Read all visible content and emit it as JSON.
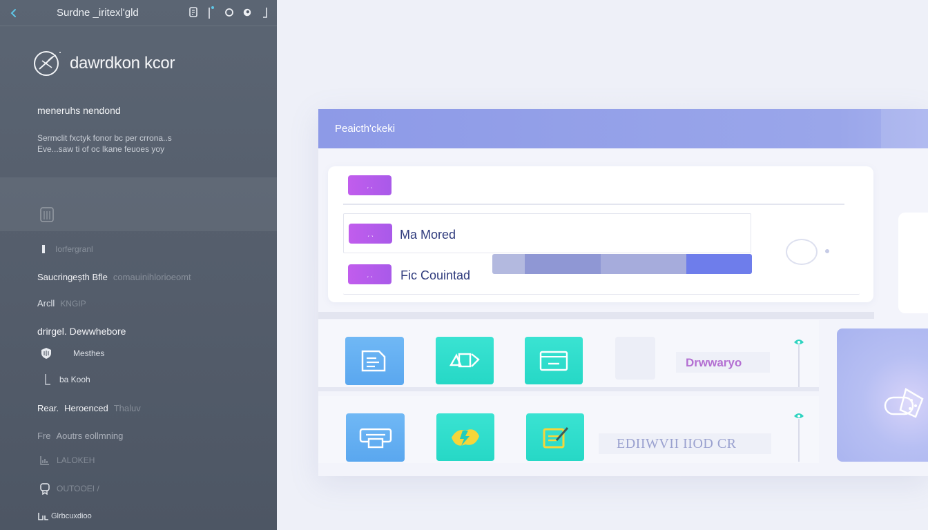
{
  "topbar": {
    "title": "Surdne _iritexlʹgld",
    "back_icon": "chevron-left-icon",
    "icons": [
      "document-icon",
      "cursor-icon",
      "circle-icon",
      "eye-icon",
      "bracket-icon"
    ]
  },
  "brand": {
    "name": "dawrdkon kcor",
    "logo_icon": "compass-logo"
  },
  "section": {
    "title": "meneruhs nendond",
    "description_line1": "Sermclit fxctyk fonor bc per crrona..s",
    "description_line2": "Eve...saw ti of oc lkane feuoes yoy"
  },
  "sidebar": {
    "items": [
      {
        "label": "Iorfergranl",
        "icon": "bar-icon",
        "style": "dim"
      },
      {
        "label": "Saucringeșth Bfle",
        "extra": "comauinihlorioeomt",
        "style": "strong"
      },
      {
        "label": "Arcll",
        "extra": "KNGIP",
        "style": "strong"
      },
      {
        "label": "drirgel. Dewwhebore",
        "style": "strong"
      },
      {
        "label": "Mesthes",
        "icon": "shield-icon",
        "style": "mid"
      },
      {
        "label": "ba Kooh",
        "icon": "bracket-icon",
        "style": "mid"
      },
      {
        "label": "Rear.",
        "extra2": "Heroenced",
        "extra": "Thaluv",
        "style": "strong"
      },
      {
        "label": "Fre",
        "extra2": "Aoutrs eollmning",
        "style": "dim"
      },
      {
        "label": "LALOKEH",
        "icon": "chart-icon",
        "style": "dim"
      },
      {
        "label": "OUTOOEI /",
        "icon": "badge-icon",
        "style": "dim"
      },
      {
        "label": "Glrbcuxdioo",
        "icon": "link-icon",
        "style": "mid"
      }
    ]
  },
  "panel": {
    "title": "Peaicthʹckeki",
    "fields": [
      {
        "pill": "ˏ ˎ",
        "label": ""
      },
      {
        "pill": "ˏ ˎ",
        "label": "Ma Mored"
      },
      {
        "pill": "ˏ ˎ",
        "label": "Fic Couintad"
      }
    ],
    "progress": 0.75
  },
  "tiles": {
    "row1": {
      "caption": "Drwwaryo",
      "items": [
        {
          "icon": "document-icon",
          "color": "#5aa7ef"
        },
        {
          "icon": "monitor-icon",
          "color": "#26d8c6"
        },
        {
          "icon": "terminal-icon",
          "color": "#26d8c6"
        }
      ]
    },
    "row2": {
      "caption": "EDIIWVII IIOD CR",
      "items": [
        {
          "icon": "folder-icon",
          "color": "#5aa7ef"
        },
        {
          "icon": "lightning-icon",
          "color": "#26d8c6"
        },
        {
          "icon": "edit-icon",
          "color": "#26d8c6"
        }
      ]
    }
  },
  "colors": {
    "sidebar": "#545d6b",
    "header": "#8d9ae7",
    "accent_purple": "#b260eb",
    "accent_teal": "#26d8c6",
    "accent_blue": "#5aa7ef",
    "progress": "#6e7deb"
  }
}
